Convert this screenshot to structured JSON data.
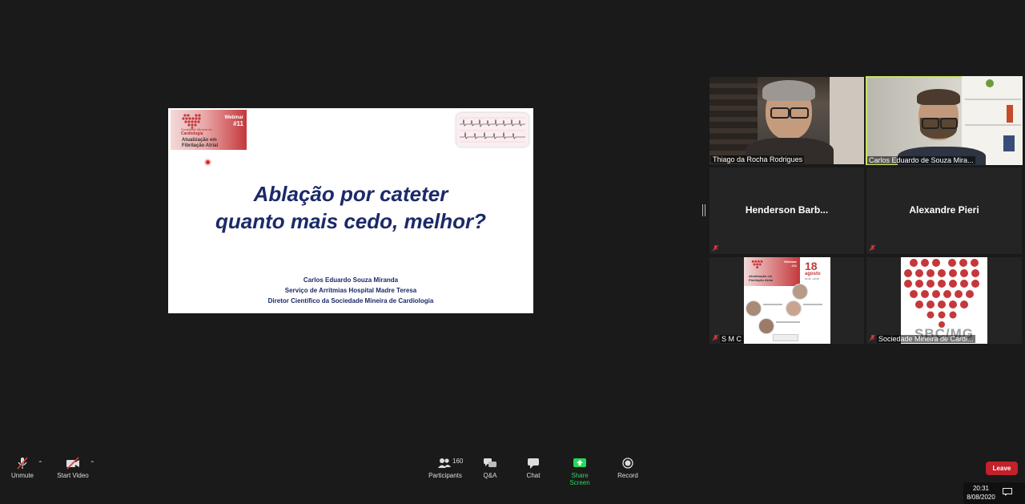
{
  "slide": {
    "logo": {
      "society": "Sociedade Mineira de",
      "cardiologia": "Cardiologia",
      "webinar_label": "Webinar",
      "webinar_number": "#11",
      "subtitle_line1": "Atualização em",
      "subtitle_line2": "Fibrilação Atrial"
    },
    "title_line1": "Ablação por cateter",
    "title_line2": "quanto mais cedo, melhor?",
    "author_name": "Carlos Eduardo Souza Miranda",
    "author_service": "Serviço de Arritmias Hospital Madre Teresa",
    "author_role": "Diretor Científico da Sociedade Mineira de Cardiologia"
  },
  "participants": [
    {
      "name": "Thiago da Rocha Rodrigues"
    },
    {
      "name": "Carlos Eduardo de Souza Mira..."
    },
    {
      "name": "Henderson  Barb..."
    },
    {
      "name": "Alexandre Pieri"
    },
    {
      "name": "S M C"
    },
    {
      "name": "Sociedade Mineira de Cardi..."
    }
  ],
  "poster": {
    "webinar": "Webinar",
    "number": "#11",
    "day": "18",
    "month": "agosto",
    "time": "20:30 - 22:30",
    "heading": "Atualização em Fibrilação Atrial"
  },
  "smc_logo": {
    "text": "SBC/MG"
  },
  "toolbar": {
    "unmute": "Unmute",
    "start_video": "Start Video",
    "participants": "Participants",
    "participant_count": "160",
    "qa": "Q&A",
    "chat": "Chat",
    "share_screen": "Share Screen",
    "record": "Record",
    "leave": "Leave"
  },
  "clock": {
    "time": "20:31",
    "date": "8/08/2020"
  },
  "colors": {
    "background": "#1a1a1a",
    "active_speaker": "#c7e564",
    "leave": "#c3212b",
    "share": "#23d959",
    "slide_text": "#1b2a68"
  }
}
